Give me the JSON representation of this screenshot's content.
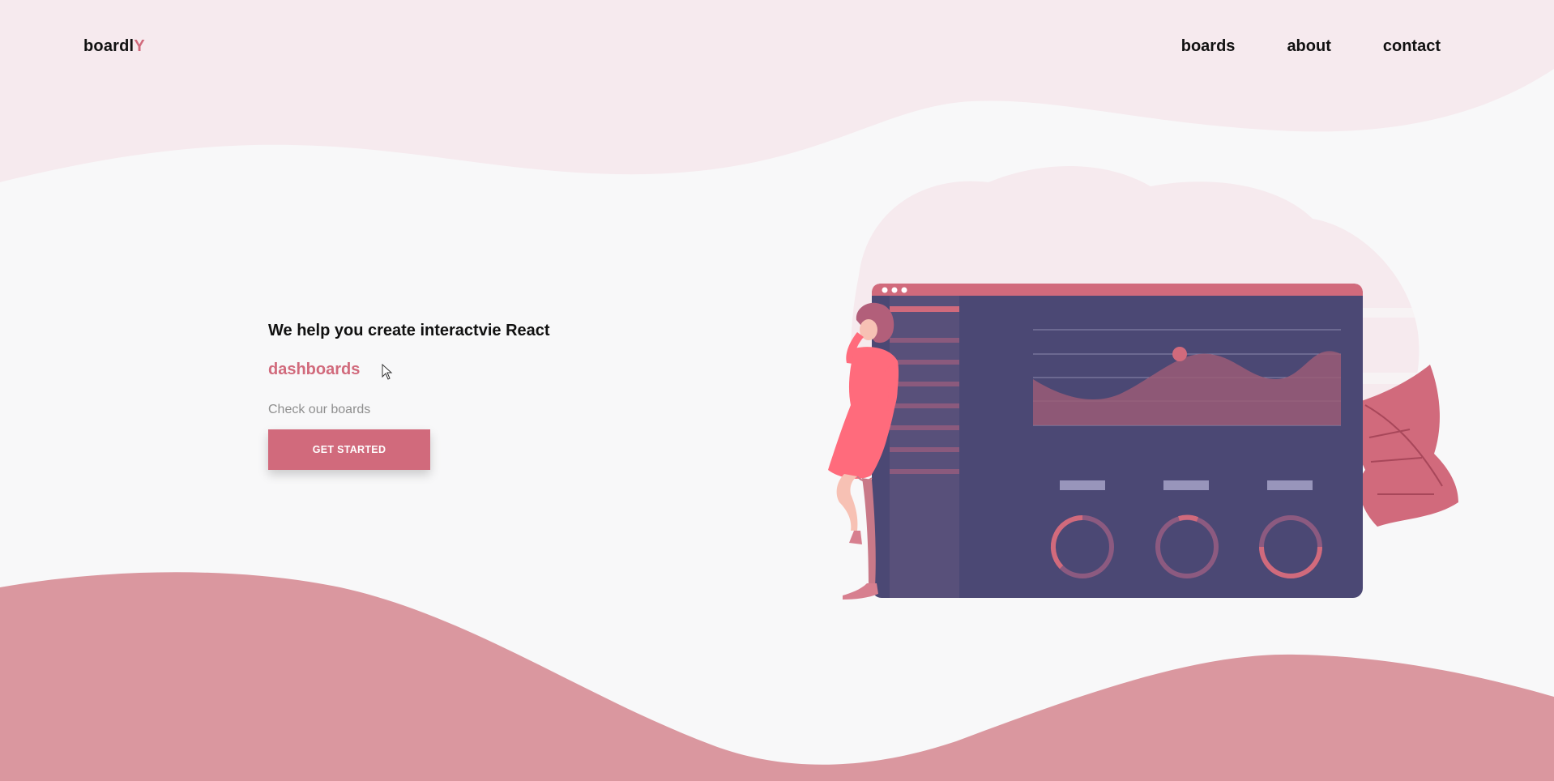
{
  "brand": {
    "name_main": "boardl",
    "name_accent": "Y"
  },
  "nav": {
    "items": [
      "boards",
      "about",
      "contact"
    ]
  },
  "hero": {
    "headline": "We help you create interactvie React",
    "accent_word": "dashboards",
    "lead": "Check our boards",
    "cta_label": "GET STARTED"
  },
  "colors": {
    "accent": "#d16a7c",
    "wave_top": "#f6eaee",
    "wave_bottom": "#da979f",
    "dashboard_bg": "#4b4874"
  }
}
